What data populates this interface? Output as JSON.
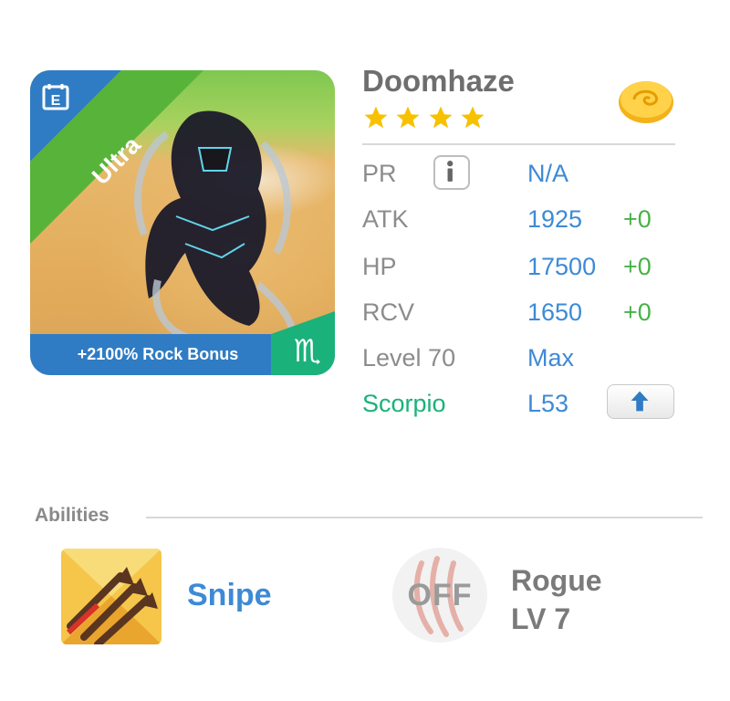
{
  "monster": {
    "name": "Doomhaze",
    "rarity": "Ultra",
    "star_count": 4,
    "bonus_text": "+2100% Rock Bonus",
    "zodiac_symbol": "♏",
    "edit_icon_letter": "E"
  },
  "stats": {
    "pr": {
      "label": "PR",
      "value": "N/A"
    },
    "atk": {
      "label": "ATK",
      "value": "1925",
      "bonus": "+0"
    },
    "hp": {
      "label": "HP",
      "value": "17500",
      "bonus": "+0"
    },
    "rcv": {
      "label": "RCV",
      "value": "1650",
      "bonus": "+0"
    },
    "level": {
      "label": "Level 70",
      "value": "Max"
    },
    "zodiac": {
      "label": "Scorpio",
      "value": "L53"
    }
  },
  "abilities": {
    "title": "Abilities",
    "skill_name": "Snipe",
    "off_label": "OFF",
    "trait_name": "Rogue",
    "trait_level": "LV 7"
  },
  "colors": {
    "accent_blue": "#3d8ad6",
    "bonus_green": "#47b247",
    "zodiac_teal": "#1ab27a",
    "ribbon_green": "#58b33a",
    "ribbon_blue": "#2f7cc4"
  },
  "icons": [
    "edit-icon",
    "star-icon",
    "coin-icon",
    "info-icon",
    "arrow-up-icon",
    "zodiac-scorpio-icon",
    "snipe-arrows-icon",
    "claw-scratch-icon"
  ]
}
